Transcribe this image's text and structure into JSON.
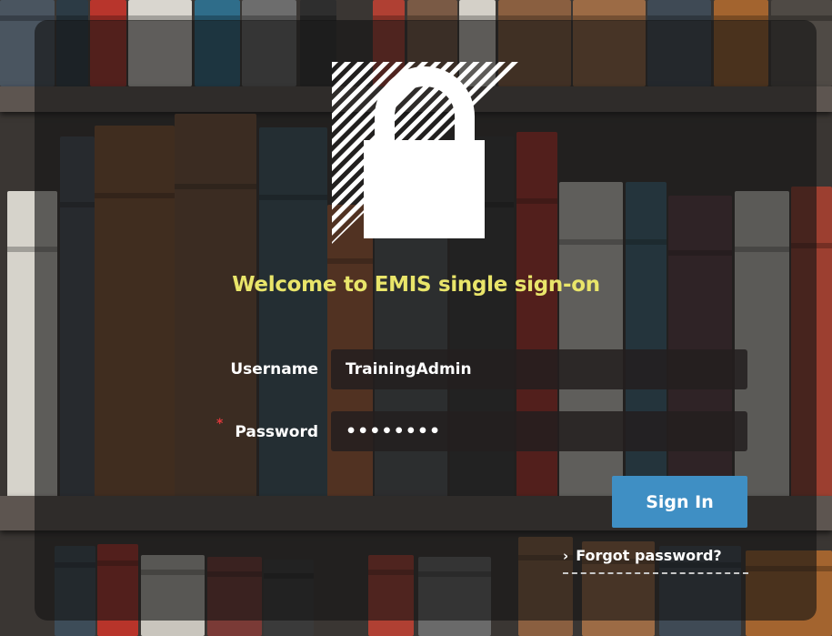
{
  "login": {
    "title": "Welcome to EMIS single sign-on",
    "username_label": "Username",
    "username_value": "TrainingAdmin",
    "password_label": "Password",
    "password_value": "••••••••",
    "required_mark": "*",
    "sign_in_label": "Sign In",
    "forgot_label": "Forgot password?",
    "forgot_chevron": "›"
  },
  "icons": {
    "logo": "padlock-icon",
    "forgot": "chevron-right-icon"
  },
  "colors": {
    "title": "#e9e56a",
    "button": "#3f8fc4",
    "required": "#e0383b"
  }
}
